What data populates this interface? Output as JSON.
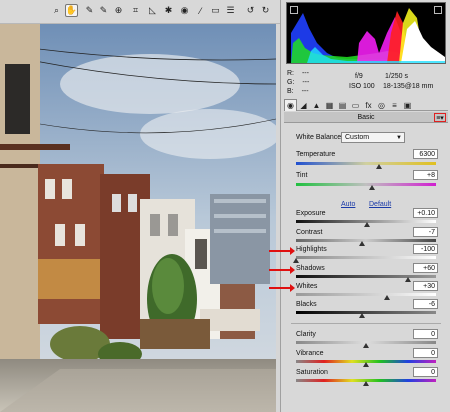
{
  "toolbar": {
    "tools": [
      {
        "name": "zoom-tool",
        "icon": "zoom-icon",
        "glyph": "⌕",
        "active": false
      },
      {
        "name": "hand-tool",
        "icon": "hand-icon",
        "glyph": "✋",
        "active": true
      },
      {
        "name": "white-balance-tool",
        "icon": "eyedropper-icon",
        "glyph": "✎",
        "active": false
      },
      {
        "name": "color-sampler-tool",
        "icon": "color-sampler-icon",
        "glyph": "✎",
        "active": false
      },
      {
        "name": "target-adjustment-tool",
        "icon": "target-icon",
        "glyph": "⊕",
        "active": false
      },
      {
        "name": "crop-tool",
        "icon": "crop-icon",
        "glyph": "⌗",
        "active": false
      },
      {
        "name": "straighten-tool",
        "icon": "straighten-icon",
        "glyph": "◺",
        "active": false
      },
      {
        "name": "spot-removal-tool",
        "icon": "spot-removal-icon",
        "glyph": "✱",
        "active": false
      },
      {
        "name": "red-eye-tool",
        "icon": "red-eye-icon",
        "glyph": "◉",
        "active": false
      },
      {
        "name": "adjustment-brush-tool",
        "icon": "brush-icon",
        "glyph": "⁄",
        "active": false
      },
      {
        "name": "graduated-filter-tool",
        "icon": "gradient-icon",
        "glyph": "▭",
        "active": false
      },
      {
        "name": "preferences-tool",
        "icon": "list-icon",
        "glyph": "☰",
        "active": false
      },
      {
        "name": "rotate-left-tool",
        "icon": "rotate-left-icon",
        "glyph": "↺",
        "active": false
      },
      {
        "name": "rotate-right-tool",
        "icon": "rotate-right-icon",
        "glyph": "↻",
        "active": false
      }
    ]
  },
  "readouts": {
    "r_label": "R:",
    "r_value": "---",
    "g_label": "G:",
    "g_value": "---",
    "b_label": "B:",
    "b_value": "---",
    "aperture": "f/9",
    "shutter": "1/250 s",
    "iso": "ISO 100",
    "lens": "18-135@18 mm"
  },
  "panel": {
    "title": "Basic",
    "menu_icon": "panel-menu-icon",
    "tab_icons": [
      "basic-icon",
      "tone-curve-icon",
      "detail-icon",
      "hsl-icon",
      "split-toning-icon",
      "lens-corrections-icon",
      "effects-icon",
      "camera-calibration-icon",
      "presets-icon",
      "snapshots-icon"
    ]
  },
  "white_balance": {
    "label": "White Balance:",
    "value": "Custom"
  },
  "auto_label": "Auto",
  "default_label": "Default",
  "sliders": {
    "temperature": {
      "label": "Temperature",
      "value": "6300",
      "position": 0.59
    },
    "tint": {
      "label": "Tint",
      "value": "+8",
      "position": 0.54
    },
    "exposure": {
      "label": "Exposure",
      "value": "+0.10",
      "position": 0.51
    },
    "contrast": {
      "label": "Contrast",
      "value": "-7",
      "position": 0.47
    },
    "highlights": {
      "label": "Highlights",
      "value": "-100",
      "position": 0.0
    },
    "shadows": {
      "label": "Shadows",
      "value": "+60",
      "position": 0.8
    },
    "whites": {
      "label": "Whites",
      "value": "+30",
      "position": 0.65
    },
    "blacks": {
      "label": "Blacks",
      "value": "-6",
      "position": 0.47
    },
    "clarity": {
      "label": "Clarity",
      "value": "0",
      "position": 0.5
    },
    "vibrance": {
      "label": "Vibrance",
      "value": "0",
      "position": 0.5
    },
    "saturation": {
      "label": "Saturation",
      "value": "0",
      "position": 0.5
    }
  },
  "colors": {
    "arrow": "#e01010",
    "link": "#1a3aa8"
  }
}
